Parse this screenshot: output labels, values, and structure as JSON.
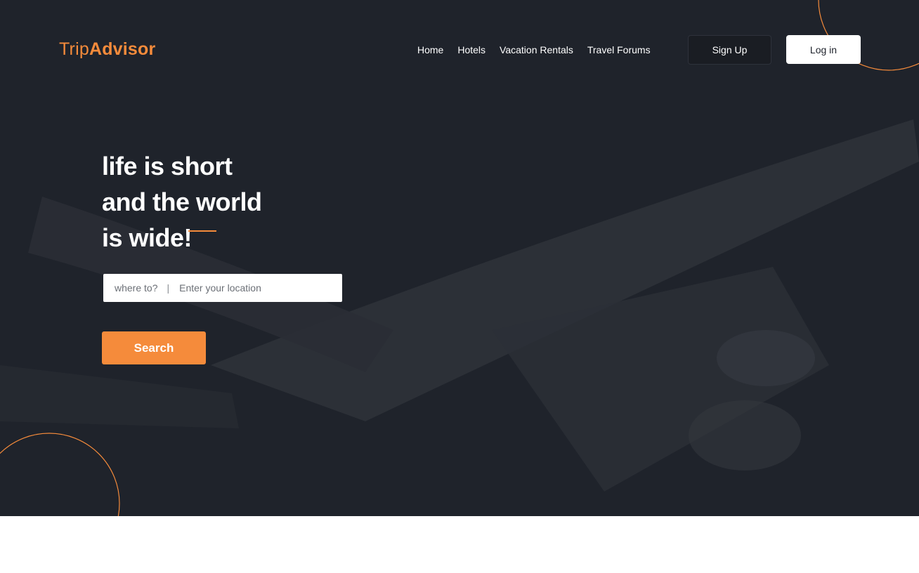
{
  "logo": {
    "part1": "Trip",
    "part2": "Advisor"
  },
  "nav": {
    "items": [
      {
        "label": "Home"
      },
      {
        "label": "Hotels"
      },
      {
        "label": "Vacation Rentals"
      },
      {
        "label": "Travel Forums"
      }
    ],
    "signup_label": "Sign Up",
    "login_label": "Log in"
  },
  "hero": {
    "headline": [
      "life is short",
      "and the world",
      "is wide!"
    ],
    "search": {
      "prefix": "where to?",
      "separator": "|",
      "placeholder": "Enter your location"
    },
    "search_button": "Search"
  },
  "colors": {
    "accent": "#f58b3b",
    "background": "#1e222b",
    "text": "#ffffff"
  }
}
